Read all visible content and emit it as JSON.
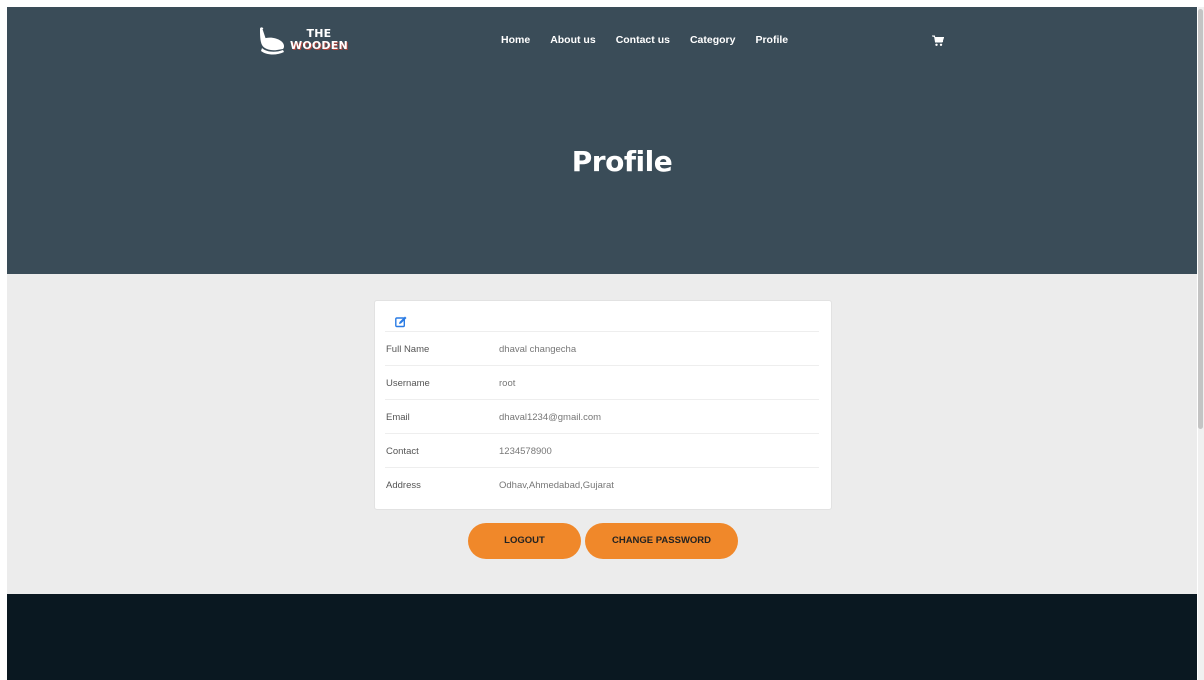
{
  "brand": {
    "line1": "THE",
    "line2": "WOODEN"
  },
  "nav": [
    {
      "label": "Home"
    },
    {
      "label": "About us"
    },
    {
      "label": "Contact us"
    },
    {
      "label": "Category"
    },
    {
      "label": "Profile"
    }
  ],
  "icons": {
    "cart": "cart-icon",
    "edit": "edit-icon",
    "logo": "chair-logo-icon"
  },
  "hero": {
    "title": "Profile"
  },
  "profile": {
    "rows": [
      {
        "label": "Full Name",
        "value": "dhaval changecha"
      },
      {
        "label": "Username",
        "value": "root"
      },
      {
        "label": "Email",
        "value": "dhaval1234@gmail.com"
      },
      {
        "label": "Contact",
        "value": "1234578900"
      },
      {
        "label": "Address",
        "value": "Odhav,Ahmedabad,Gujarat"
      }
    ]
  },
  "buttons": {
    "logout": "LOGOUT",
    "change_password": "CHANGE PASSWORD"
  },
  "colors": {
    "hero": "#3a4c58",
    "accent": "#f0882a",
    "footer": "#0a1821",
    "edit": "#2a7be4"
  }
}
